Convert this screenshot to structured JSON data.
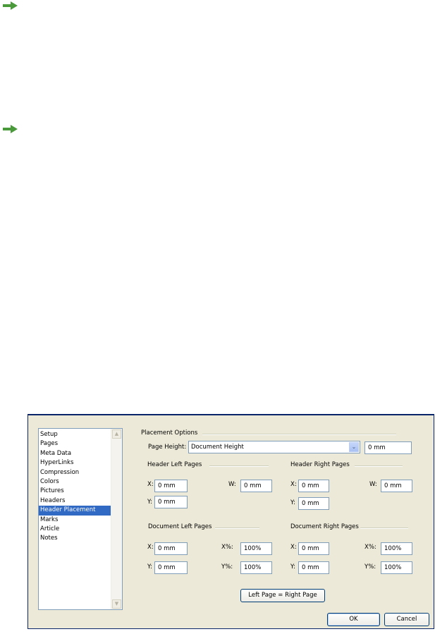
{
  "colors": {
    "arrow": "#4a9a3c",
    "selection": "#316ac5",
    "dialog_bg": "#ece9d8"
  },
  "icons": [
    "arrow-right-icon",
    "arrow-right-icon",
    "scroll-up-icon",
    "scroll-down-icon",
    "dropdown-chevron-icon"
  ],
  "sidebar": {
    "items": [
      {
        "label": "Setup"
      },
      {
        "label": "Pages"
      },
      {
        "label": "Meta Data"
      },
      {
        "label": "HyperLinks"
      },
      {
        "label": "Compression"
      },
      {
        "label": "Colors"
      },
      {
        "label": "Pictures"
      },
      {
        "label": "Headers"
      },
      {
        "label": "Header Placement",
        "selected": true
      },
      {
        "label": "Marks"
      },
      {
        "label": "Article"
      },
      {
        "label": "Notes"
      }
    ]
  },
  "placement": {
    "title": "Placement Options",
    "page_height_label": "Page Height:",
    "page_height_value": "Document Height",
    "page_height_mm": "0 mm"
  },
  "header_left": {
    "title": "Header Left Pages",
    "x_label": "X:",
    "x_value": "0 mm",
    "y_label": "Y:",
    "y_value": "0 mm",
    "w_label": "W:",
    "w_value": "0 mm"
  },
  "header_right": {
    "title": "Header Right Pages",
    "x_label": "X:",
    "x_value": "0 mm",
    "y_label": "Y:",
    "y_value": "0 mm",
    "w_label": "W:",
    "w_value": "0 mm"
  },
  "doc_left": {
    "title": "Document Left Pages",
    "x_label": "X:",
    "x_value": "0 mm",
    "y_label": "Y:",
    "y_value": "0 mm",
    "xp_label": "X%:",
    "xp_value": "100%",
    "yp_label": "Y%:",
    "yp_value": "100%"
  },
  "doc_right": {
    "title": "Document Right Pages",
    "x_label": "X:",
    "x_value": "0 mm",
    "y_label": "Y:",
    "y_value": "0 mm",
    "xp_label": "X%:",
    "xp_value": "100%",
    "yp_label": "Y%:",
    "yp_value": "100%"
  },
  "buttons": {
    "left_eq_right": "Left Page = Right Page",
    "ok": "OK",
    "cancel": "Cancel"
  }
}
